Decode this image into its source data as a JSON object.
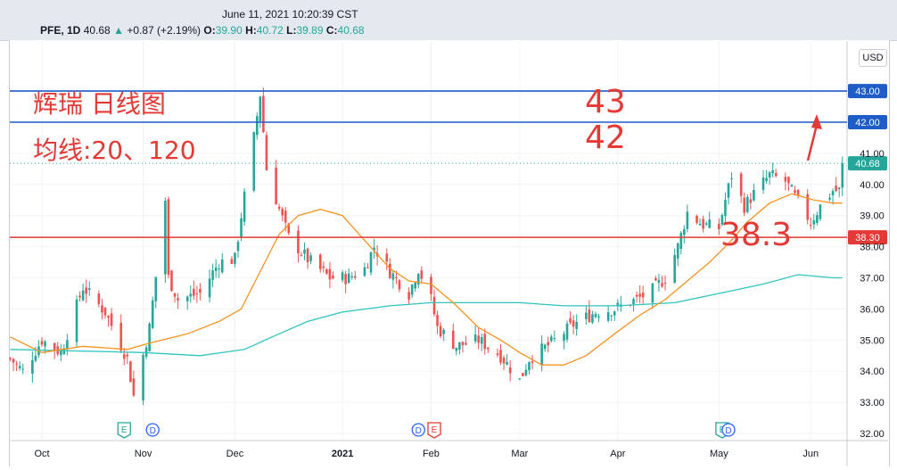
{
  "header": {
    "timestamp": "June 11, 2021  10:20:39 CST",
    "symbol": "PFE, 1D",
    "last": "40.68",
    "change": "+0.87 (+2.19%)",
    "o_label": "O:",
    "o": "39.90",
    "h_label": "H:",
    "h": "40.72",
    "l_label": "L:",
    "l": "39.89",
    "c_label": "C:",
    "c": "40.68",
    "currency": "USD"
  },
  "colors": {
    "up": "#26a69a",
    "down": "#ef5350",
    "ma20": "#f7931e",
    "ma120": "#2ec4c0",
    "line_blue": "#1e5cc8",
    "line_red": "#e53935",
    "annot": "#e53935",
    "grid": "#f0f3f8"
  },
  "chart_data": {
    "type": "candlestick",
    "y_ticks": [
      "32.00",
      "33.00",
      "34.00",
      "35.00",
      "36.00",
      "37.00",
      "38.00",
      "39.00",
      "40.00",
      "41.00",
      "42.00",
      "43.00"
    ],
    "x_ticks": [
      {
        "label": "Oct",
        "date": "2020-10-01"
      },
      {
        "label": "Nov",
        "date": "2020-11-02"
      },
      {
        "label": "Dec",
        "date": "2020-12-01"
      },
      {
        "label": "2021",
        "date": "2021-01-04",
        "bold": true
      },
      {
        "label": "Feb",
        "date": "2021-02-01"
      },
      {
        "label": "Mar",
        "date": "2021-03-01"
      },
      {
        "label": "Apr",
        "date": "2021-04-01"
      },
      {
        "label": "May",
        "date": "2021-05-03"
      },
      {
        "label": "Jun",
        "date": "2021-06-01"
      }
    ],
    "key_points": [
      [
        "2020-09-21",
        34.4
      ],
      [
        "2020-09-25",
        34.0
      ],
      [
        "2020-10-01",
        35.0
      ],
      [
        "2020-10-07",
        34.6
      ],
      [
        "2020-10-14",
        36.7
      ],
      [
        "2020-10-21",
        35.9
      ],
      [
        "2020-10-28",
        34.4
      ],
      [
        "2020-10-30",
        33.2
      ],
      [
        "2020-11-04",
        35.4
      ],
      [
        "2020-11-09",
        39.5
      ],
      [
        "2020-11-10",
        37.0
      ],
      [
        "2020-11-13",
        36.3
      ],
      [
        "2020-11-20",
        36.5
      ],
      [
        "2020-11-26",
        37.5
      ],
      [
        "2020-12-01",
        37.6
      ],
      [
        "2020-12-03",
        39.0
      ],
      [
        "2020-12-07",
        41.5
      ],
      [
        "2020-12-09",
        42.9
      ],
      [
        "2020-12-11",
        40.5
      ],
      [
        "2020-12-15",
        39.2
      ],
      [
        "2020-12-18",
        38.3
      ],
      [
        "2020-12-24",
        37.6
      ],
      [
        "2020-12-31",
        37.0
      ],
      [
        "2021-01-06",
        37.0
      ],
      [
        "2021-01-11",
        37.3
      ],
      [
        "2021-01-14",
        38.0
      ],
      [
        "2021-01-19",
        37.2
      ],
      [
        "2021-01-25",
        36.5
      ],
      [
        "2021-01-28",
        37.3
      ],
      [
        "2021-02-01",
        36.3
      ],
      [
        "2021-02-03",
        35.4
      ],
      [
        "2021-02-09",
        34.8
      ],
      [
        "2021-02-16",
        35.0
      ],
      [
        "2021-02-23",
        34.5
      ],
      [
        "2021-03-01",
        33.7
      ],
      [
        "2021-03-04",
        34.4
      ],
      [
        "2021-03-11",
        34.9
      ],
      [
        "2021-03-18",
        35.5
      ],
      [
        "2021-03-25",
        35.9
      ],
      [
        "2021-03-31",
        36.0
      ],
      [
        "2021-04-07",
        36.3
      ],
      [
        "2021-04-12",
        36.6
      ],
      [
        "2021-04-16",
        37.0
      ],
      [
        "2021-04-20",
        38.0
      ],
      [
        "2021-04-23",
        39.1
      ],
      [
        "2021-04-28",
        38.7
      ],
      [
        "2021-05-03",
        38.6
      ],
      [
        "2021-05-05",
        39.5
      ],
      [
        "2021-05-07",
        40.3
      ],
      [
        "2021-05-11",
        39.3
      ],
      [
        "2021-05-14",
        39.7
      ],
      [
        "2021-05-19",
        40.3
      ],
      [
        "2021-05-24",
        40.1
      ],
      [
        "2021-05-27",
        39.6
      ],
      [
        "2021-06-01",
        38.8
      ],
      [
        "2021-06-04",
        39.3
      ],
      [
        "2021-06-08",
        39.8
      ],
      [
        "2021-06-10",
        39.8
      ],
      [
        "2021-06-11",
        40.68
      ]
    ],
    "ma20": [
      [
        "2020-09-21",
        35.1
      ],
      [
        "2020-10-01",
        34.6
      ],
      [
        "2020-10-14",
        34.8
      ],
      [
        "2020-10-28",
        34.7
      ],
      [
        "2020-11-04",
        34.9
      ],
      [
        "2020-11-16",
        35.2
      ],
      [
        "2020-11-26",
        35.6
      ],
      [
        "2020-12-03",
        36.0
      ],
      [
        "2020-12-09",
        37.2
      ],
      [
        "2020-12-15",
        38.4
      ],
      [
        "2020-12-21",
        39.0
      ],
      [
        "2020-12-28",
        39.2
      ],
      [
        "2021-01-04",
        39.0
      ],
      [
        "2021-01-11",
        38.2
      ],
      [
        "2021-01-19",
        37.3
      ],
      [
        "2021-01-25",
        36.9
      ],
      [
        "2021-02-01",
        36.8
      ],
      [
        "2021-02-08",
        36.2
      ],
      [
        "2021-02-16",
        35.4
      ],
      [
        "2021-02-23",
        35.0
      ],
      [
        "2021-03-01",
        34.6
      ],
      [
        "2021-03-08",
        34.2
      ],
      [
        "2021-03-15",
        34.2
      ],
      [
        "2021-03-22",
        34.5
      ],
      [
        "2021-03-31",
        35.2
      ],
      [
        "2021-04-08",
        35.8
      ],
      [
        "2021-04-16",
        36.3
      ],
      [
        "2021-04-23",
        36.9
      ],
      [
        "2021-04-30",
        37.5
      ],
      [
        "2021-05-06",
        38.1
      ],
      [
        "2021-05-12",
        38.8
      ],
      [
        "2021-05-19",
        39.4
      ],
      [
        "2021-05-26",
        39.7
      ],
      [
        "2021-06-02",
        39.5
      ],
      [
        "2021-06-08",
        39.4
      ],
      [
        "2021-06-11",
        39.4
      ]
    ],
    "ma120": [
      [
        "2020-09-21",
        34.7
      ],
      [
        "2020-11-02",
        34.6
      ],
      [
        "2020-11-20",
        34.5
      ],
      [
        "2020-12-04",
        34.7
      ],
      [
        "2020-12-15",
        35.2
      ],
      [
        "2020-12-24",
        35.6
      ],
      [
        "2021-01-04",
        35.9
      ],
      [
        "2021-01-19",
        36.1
      ],
      [
        "2021-02-01",
        36.2
      ],
      [
        "2021-02-16",
        36.2
      ],
      [
        "2021-03-01",
        36.2
      ],
      [
        "2021-03-15",
        36.1
      ],
      [
        "2021-04-01",
        36.1
      ],
      [
        "2021-04-19",
        36.2
      ],
      [
        "2021-05-03",
        36.5
      ],
      [
        "2021-05-17",
        36.8
      ],
      [
        "2021-05-28",
        37.1
      ],
      [
        "2021-06-08",
        37.0
      ],
      [
        "2021-06-11",
        37.0
      ]
    ],
    "levels": [
      {
        "value": 43.0,
        "label": "43.00",
        "color": "#1e5cc8"
      },
      {
        "value": 42.0,
        "label": "42.00",
        "color": "#1e5cc8"
      },
      {
        "value": 38.3,
        "label": "38.30",
        "color": "#e53935"
      }
    ],
    "last_price": {
      "value": 40.68,
      "label": "40.68"
    },
    "events": [
      {
        "date": "2020-10-27",
        "letter": "E",
        "type": "earnings"
      },
      {
        "date": "2020-11-05",
        "letter": "D",
        "type": "dividend"
      },
      {
        "date": "2021-01-28",
        "letter": "D",
        "type": "dividend"
      },
      {
        "date": "2021-02-02",
        "letter": "E",
        "type": "earnings-red"
      },
      {
        "date": "2021-05-04",
        "letter": "E",
        "type": "earnings"
      },
      {
        "date": "2021-05-06",
        "letter": "D",
        "type": "dividend"
      }
    ]
  },
  "annotations": {
    "title": "辉瑞 日线图",
    "ma_note": "均线:20、120",
    "level_43": "43",
    "level_42": "42",
    "level_383": "38.3"
  }
}
